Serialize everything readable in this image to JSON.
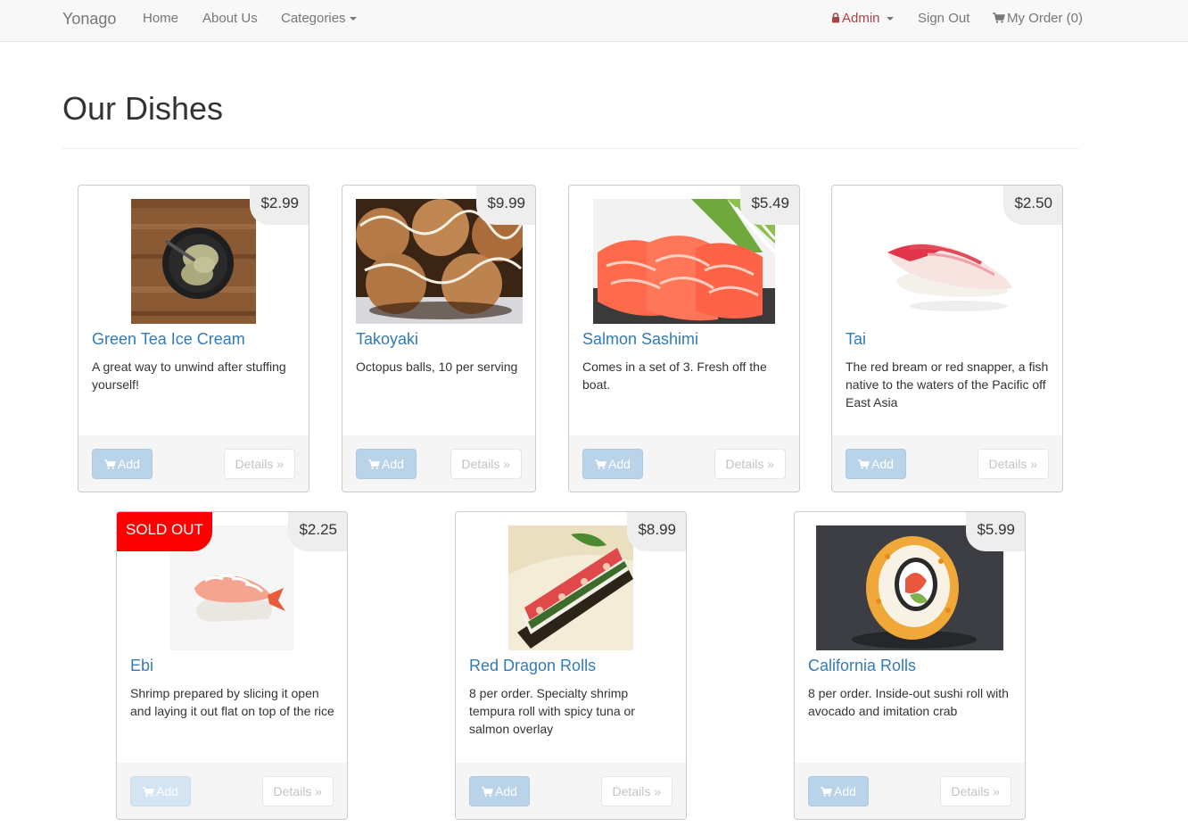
{
  "navbar": {
    "brand": "Yonago",
    "home": "Home",
    "about": "About Us",
    "categories": "Categories",
    "admin": "Admin",
    "sign_out": "Sign Out",
    "my_order": "My Order (0)"
  },
  "page": {
    "title": "Our Dishes"
  },
  "dishes": [
    {
      "name": "Green Tea Ice Cream",
      "price": "$2.99",
      "description": "A great way to unwind after stuffing yourself!",
      "add_label": "Add",
      "details_label": "Details »",
      "image": "green-tea-ice-cream-photo"
    },
    {
      "name": "Takoyaki",
      "price": "$9.99",
      "description": "Octopus balls, 10 per serving",
      "add_label": "Add",
      "details_label": "Details »",
      "image": "takoyaki-photo"
    },
    {
      "name": "Salmon Sashimi",
      "price": "$5.49",
      "description": "Comes in a set of 3. Fresh off the boat.",
      "add_label": "Add",
      "details_label": "Details »",
      "image": "salmon-sashimi-photo"
    },
    {
      "name": "Tai",
      "price": "$2.50",
      "description": "The red bream or red snapper, a fish native to the waters of the Pacific off East Asia",
      "add_label": "Add",
      "details_label": "Details »",
      "image": "tai-nigiri-photo"
    },
    {
      "name": "Ebi",
      "price": "$2.25",
      "badge": "SOLD OUT",
      "description": "Shrimp prepared by slicing it open and laying it out flat on top of the rice",
      "add_label": "Add",
      "details_label": "Details »",
      "image": "ebi-nigiri-photo"
    },
    {
      "name": "Red Dragon Rolls",
      "price": "$8.99",
      "description": "8 per order. Specialty shrimp tempura roll with spicy tuna or salmon overlay",
      "add_label": "Add",
      "details_label": "Details »",
      "image": "red-dragon-roll-photo"
    },
    {
      "name": "California Rolls",
      "price": "$5.99",
      "description": "8 per order. Inside-out sushi roll with avocado and imitation crab",
      "add_label": "Add",
      "details_label": "Details »",
      "image": "california-roll-photo"
    }
  ],
  "colors": {
    "navbar_bg": "#f8f8f8",
    "link": "#337ab7",
    "admin": "#a94442",
    "sold_out": "#ff0000",
    "price_tag_bg": "#eeeeee",
    "add_button_disabled": "#b9d3e9"
  },
  "icons": {
    "admin": "lock-icon",
    "order": "shopping-cart-icon",
    "add": "shopping-cart-icon",
    "dropdown": "caret-down-icon"
  }
}
